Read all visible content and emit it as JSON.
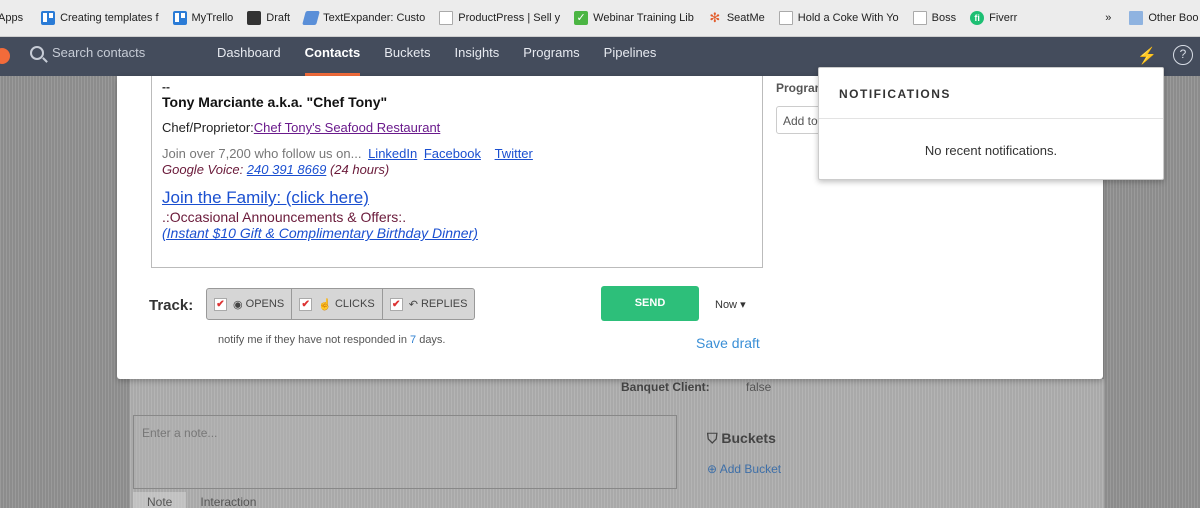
{
  "bookmarks": [
    {
      "label": "Apps",
      "icon": "none"
    },
    {
      "label": "Creating templates f",
      "icon": "trello"
    },
    {
      "label": "MyTrello",
      "icon": "trello"
    },
    {
      "label": "Draft",
      "icon": "draft"
    },
    {
      "label": "TextExpander: Custo",
      "icon": "tx"
    },
    {
      "label": "ProductPress | Sell y",
      "icon": "page"
    },
    {
      "label": "Webinar Training Lib",
      "icon": "check"
    },
    {
      "label": "SeatMe",
      "icon": "star"
    },
    {
      "label": "Hold a Coke With Yo",
      "icon": "page"
    },
    {
      "label": "Boss",
      "icon": "page"
    },
    {
      "label": "Fiverr",
      "icon": "fiverr"
    },
    {
      "label": "»",
      "icon": "none"
    },
    {
      "label": "Other Boo",
      "icon": "folder"
    }
  ],
  "nav": {
    "search_placeholder": "Search contacts",
    "items": [
      "Dashboard",
      "Contacts",
      "Buckets",
      "Insights",
      "Programs",
      "Pipelines"
    ],
    "active": "Contacts",
    "bolt": "⚡",
    "help": "?"
  },
  "signature": {
    "dash": "--",
    "name": "Tony Marciante a.k.a. \"Chef Tony\"",
    "role_prefix": "Chef/Proprietor:",
    "restaurant_link": "Chef Tony's Seafood Restaurant",
    "join_text": "Join over 7,200 who follow us on...",
    "linkedin": "LinkedIn",
    "facebook": "Facebook",
    "twitter": "Twitter",
    "voice_prefix": "Google Voice: ",
    "voice_number": "240 391 8669",
    "voice_suffix": "  (24 hours)",
    "family_link": "Join the Family: (click here)",
    "occasional": ".:Occasional Announcements & Offers:.",
    "gift_link": "(Instant $10 Gift & Complimentary Birthday Dinner)"
  },
  "compose": {
    "track_label": "Track:",
    "opens": "OPENS",
    "clicks": "CLICKS",
    "replies": "REPLIES",
    "check": "✔",
    "send": "SEND",
    "schedule": "Now",
    "notify_prefix": "notify me if they have not responded in ",
    "notify_days": "7",
    "notify_suffix": " days.",
    "save_draft": "Save draft"
  },
  "side": {
    "programs_label": "Prograr",
    "add_placeholder": "Add to"
  },
  "notifications": {
    "title": "NOTIFICATIONS",
    "empty": "No recent notifications."
  },
  "background": {
    "banquet_label": "Banquet Client:",
    "banquet_value": "false",
    "note_placeholder": "Enter a note...",
    "buckets_heading": "Buckets",
    "add_bucket": "Add Bucket",
    "tabs": [
      "Note",
      "Interaction"
    ]
  },
  "colors": {
    "nav_bg": "#444c5c",
    "accent": "#f26b3a",
    "send": "#2dbf7a",
    "link": "#3a8fd6"
  }
}
